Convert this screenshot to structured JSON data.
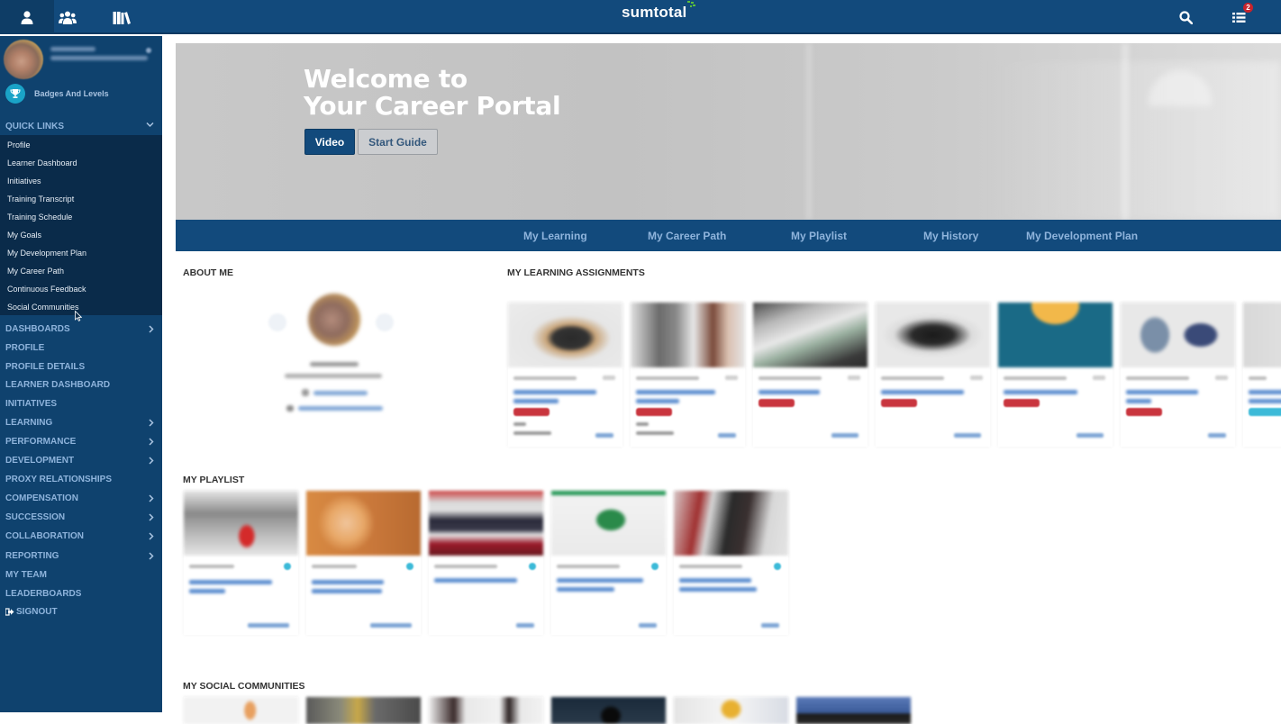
{
  "topbar": {
    "tabs": [
      {
        "name": "profile-tab",
        "icon": "user-icon",
        "active": true
      },
      {
        "name": "people-tab",
        "icon": "users-group-icon",
        "active": false
      },
      {
        "name": "library-tab",
        "icon": "library-books-icon",
        "active": false
      }
    ],
    "logo_text": "sumtotal",
    "search_icon": "search-icon",
    "tasks_icon": "task-list-icon",
    "tasks_badge_count": "2",
    "colors": {
      "bar": "#124a7c",
      "badge": "#c8232c",
      "logo_mark": "#5cbf3a"
    }
  },
  "sidebar": {
    "badges_label": "Badges And Levels",
    "quick_links": {
      "header": "QUICK LINKS",
      "expanded": true,
      "items": [
        "Profile",
        "Learner Dashboard",
        "Initiatives",
        "Training Transcript",
        "Training Schedule",
        "My Goals",
        "My Development Plan",
        "My Career Path",
        "Continuous Feedback",
        "Social Communities"
      ]
    },
    "nav": [
      {
        "label": "DASHBOARDS",
        "has_children": true
      },
      {
        "label": "PROFILE",
        "has_children": false
      },
      {
        "label": "PROFILE DETAILS",
        "has_children": false
      },
      {
        "label": "LEARNER DASHBOARD",
        "has_children": false
      },
      {
        "label": "INITIATIVES",
        "has_children": false
      },
      {
        "label": "LEARNING",
        "has_children": true
      },
      {
        "label": "PERFORMANCE",
        "has_children": true
      },
      {
        "label": "DEVELOPMENT",
        "has_children": true
      },
      {
        "label": "PROXY RELATIONSHIPS",
        "has_children": false
      },
      {
        "label": "COMPENSATION",
        "has_children": true
      },
      {
        "label": "SUCCESSION",
        "has_children": true
      },
      {
        "label": "COLLABORATION",
        "has_children": true
      },
      {
        "label": "REPORTING",
        "has_children": true
      },
      {
        "label": "MY TEAM",
        "has_children": false
      },
      {
        "label": "LEADERBOARDS",
        "has_children": false
      },
      {
        "label": "SIGNOUT",
        "has_children": false,
        "icon": "signout-icon"
      }
    ],
    "colors": {
      "bg": "#0f426e",
      "quick_bg": "#0a2b4a",
      "nav_text": "#8fb4dc",
      "trophy": "#1aa3c7"
    }
  },
  "hero": {
    "title_line1": "Welcome to",
    "title_line2": "Your Career Portal",
    "video_button": "Video",
    "guide_button": "Start Guide"
  },
  "tabs": [
    "My Learning",
    "My Career Path",
    "My Playlist",
    "My History",
    "My Development Plan"
  ],
  "sections": {
    "about_me": "ABOUT ME",
    "learning_assignments": "MY LEARNING ASSIGNMENTS",
    "playlist": "MY PLAYLIST",
    "social_communities": "MY SOCIAL COMMUNITIES"
  },
  "learning_assignments": [
    {
      "thumb": "woman-stressed",
      "status": "red"
    },
    {
      "thumb": "manager-employee",
      "status": "red"
    },
    {
      "thumb": "office-desk",
      "status": "red"
    },
    {
      "thumb": "crowd-silhouette",
      "status": "red"
    },
    {
      "thumb": "welcome-banner",
      "status": "red"
    },
    {
      "thumb": "clipboard-monitor",
      "status": "red"
    },
    {
      "thumb": "partial-card",
      "status": "cyan"
    }
  ],
  "playlist": [
    {
      "thumb": "change-graphic"
    },
    {
      "thumb": "orange-hexagon"
    },
    {
      "thumb": "panel-discussion"
    },
    {
      "thumb": "green-book"
    },
    {
      "thumb": "business-people"
    }
  ],
  "social_communities": [
    {
      "thumb": "hand-raised"
    },
    {
      "thumb": "workshop"
    },
    {
      "thumb": "office-people"
    },
    {
      "thumb": "dark-silhouette"
    },
    {
      "thumb": "trophy"
    },
    {
      "thumb": "video-player"
    }
  ]
}
